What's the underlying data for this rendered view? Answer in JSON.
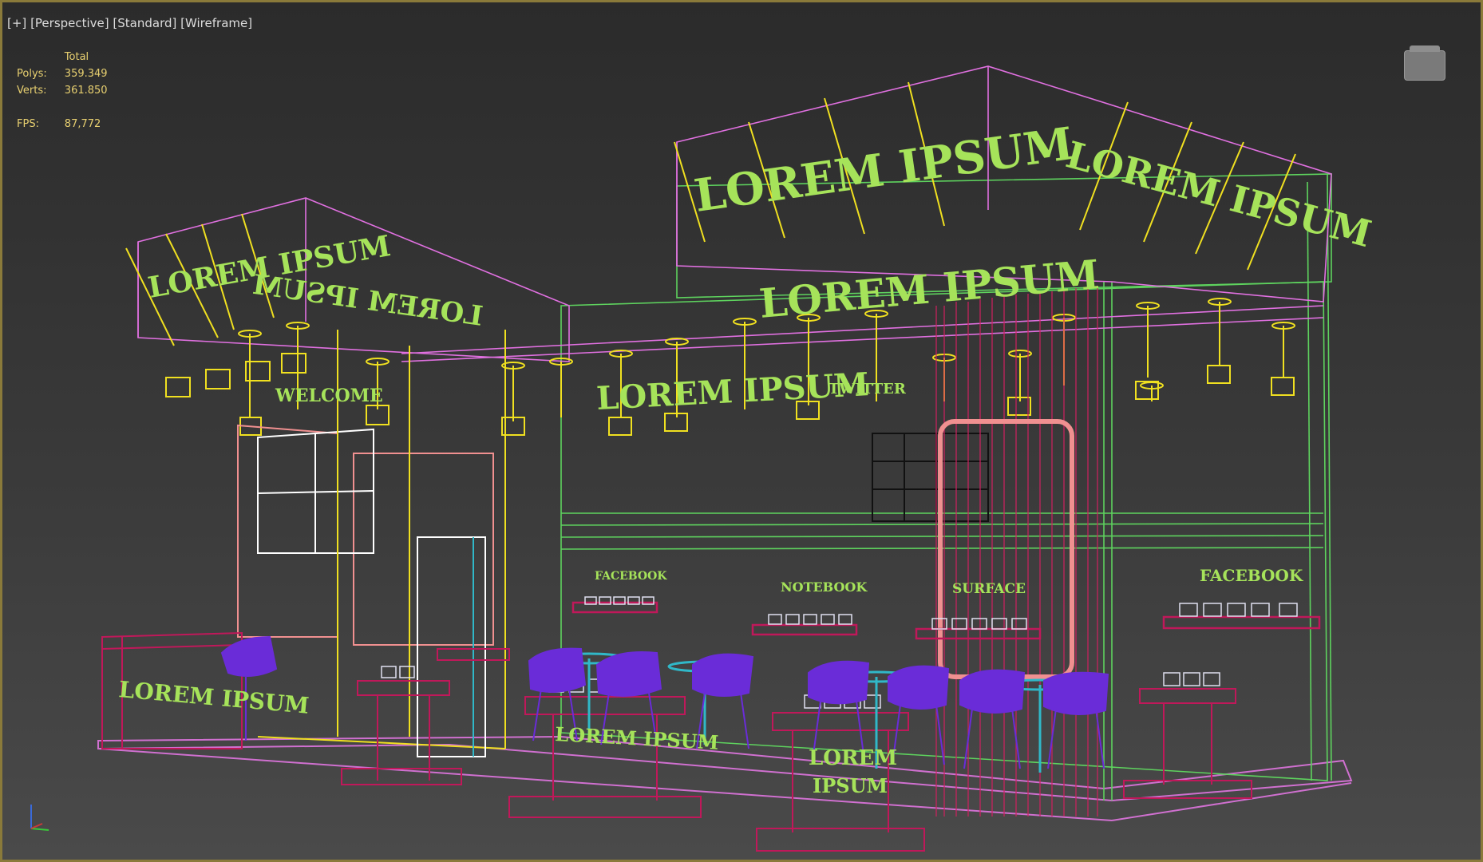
{
  "viewport": {
    "labels": [
      "[+]",
      "[Perspective]",
      "[Standard]",
      "[Wireframe]"
    ]
  },
  "stats": {
    "header": "Total",
    "rows": [
      {
        "label": "Polys:",
        "value": "359.349"
      },
      {
        "label": "Verts:",
        "value": "361.850"
      }
    ],
    "fps_label": "FPS:",
    "fps_value": "87,772"
  },
  "scene": {
    "signs": {
      "top_center": "LOREM IPSUM",
      "top_right": "LOREM IPSUM",
      "top_left": "LOREM IPSUM",
      "fascia_main": "LOREM IPSUM",
      "fascia_low": "LOREM IPSUM",
      "left_back_mirrored": "LOREM IPSUM",
      "welcome": "WELCOME",
      "twitter": "TWITTER",
      "facebook_small": "FACEBOOK",
      "notebook": "NOTEBOOK",
      "surface": "SURFACE",
      "facebook_large": "FACEBOOK",
      "counter_left": "LOREM IPSUM",
      "counter_center": "LOREM IPSUM",
      "table_front_1": "LOREM",
      "table_front_2": "IPSUM"
    },
    "colors": {
      "structure_green": "#5ed35e",
      "frame_pink": "#e070e0",
      "lights_yellow": "#f0e020",
      "furniture_magenta": "#c0185a",
      "chairs_purple": "#6a2cd8",
      "tables_cyan": "#30b8c8",
      "sign_green": "#a6e35a"
    }
  },
  "icons": {
    "viewcube": "viewcube-icon",
    "axis": "axis-tripod-icon"
  }
}
